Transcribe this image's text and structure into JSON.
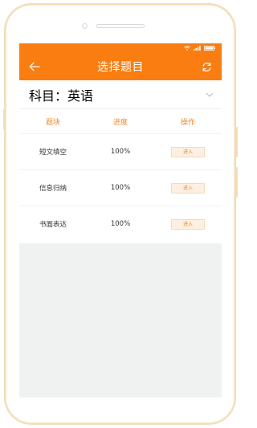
{
  "header": {
    "title": "选择题目"
  },
  "subject": {
    "label": "科目：英语"
  },
  "table": {
    "columns": [
      "题块",
      "进度",
      "操作"
    ],
    "rows": [
      {
        "block": "短文填空",
        "progress": "100%",
        "action": "进入"
      },
      {
        "block": "信息归纳",
        "progress": "100%",
        "action": "进入"
      },
      {
        "block": "书面表达",
        "progress": "100%",
        "action": "进入"
      }
    ]
  },
  "colors": {
    "accent": "#f97d10",
    "accent_text": "#f08a2a",
    "background": "#f0f1f1"
  }
}
